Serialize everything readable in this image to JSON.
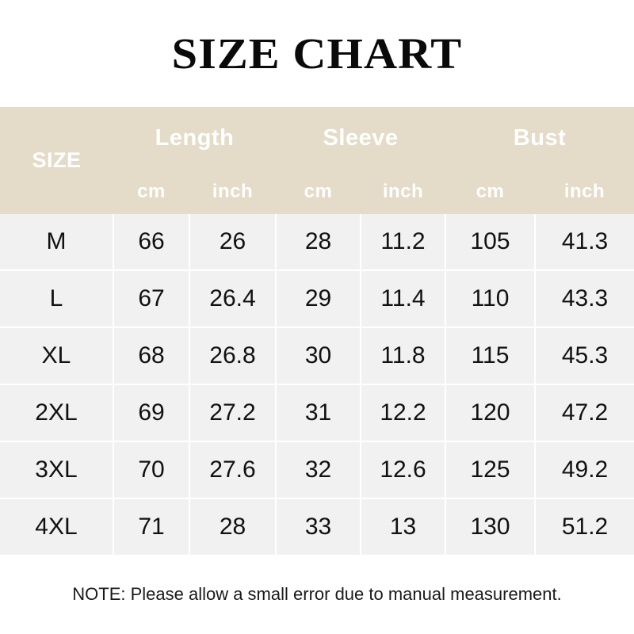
{
  "title": "SIZE CHART",
  "colors": {
    "header_band": "#e4dbc8",
    "cell_background": "#f1f1f1",
    "gridline": "#ffffff",
    "header_text": "#ffffff",
    "body_text": "#111111",
    "page_background": "#ffffff"
  },
  "table": {
    "size_column_header": "SIZE",
    "groups": [
      {
        "label": "Length",
        "units": [
          "cm",
          "inch"
        ]
      },
      {
        "label": "Sleeve",
        "units": [
          "cm",
          "inch"
        ]
      },
      {
        "label": "Bust",
        "units": [
          "cm",
          "inch"
        ]
      }
    ],
    "rows": [
      {
        "size": "M",
        "length_cm": "66",
        "length_inch": "26",
        "sleeve_cm": "28",
        "sleeve_inch": "11.2",
        "bust_cm": "105",
        "bust_inch": "41.3"
      },
      {
        "size": "L",
        "length_cm": "67",
        "length_inch": "26.4",
        "sleeve_cm": "29",
        "sleeve_inch": "11.4",
        "bust_cm": "110",
        "bust_inch": "43.3"
      },
      {
        "size": "XL",
        "length_cm": "68",
        "length_inch": "26.8",
        "sleeve_cm": "30",
        "sleeve_inch": "11.8",
        "bust_cm": "115",
        "bust_inch": "45.3"
      },
      {
        "size": "2XL",
        "length_cm": "69",
        "length_inch": "27.2",
        "sleeve_cm": "31",
        "sleeve_inch": "12.2",
        "bust_cm": "120",
        "bust_inch": "47.2"
      },
      {
        "size": "3XL",
        "length_cm": "70",
        "length_inch": "27.6",
        "sleeve_cm": "32",
        "sleeve_inch": "12.6",
        "bust_cm": "125",
        "bust_inch": "49.2"
      },
      {
        "size": "4XL",
        "length_cm": "71",
        "length_inch": "28",
        "sleeve_cm": "33",
        "sleeve_inch": "13",
        "bust_cm": "130",
        "bust_inch": "51.2"
      }
    ]
  },
  "note": "NOTE: Please allow a small error due to manual measurement.",
  "chart_data": {
    "type": "table",
    "title": "SIZE CHART",
    "columns": [
      "SIZE",
      "Length cm",
      "Length inch",
      "Sleeve cm",
      "Sleeve inch",
      "Bust cm",
      "Bust inch"
    ],
    "rows": [
      [
        "M",
        66,
        26,
        28,
        11.2,
        105,
        41.3
      ],
      [
        "L",
        67,
        26.4,
        29,
        11.4,
        110,
        43.3
      ],
      [
        "XL",
        68,
        26.8,
        30,
        11.8,
        115,
        45.3
      ],
      [
        "2XL",
        69,
        27.2,
        31,
        12.2,
        120,
        47.2
      ],
      [
        "3XL",
        70,
        27.6,
        32,
        12.6,
        125,
        49.2
      ],
      [
        "4XL",
        71,
        28,
        33,
        13,
        130,
        51.2
      ]
    ],
    "annotations": [
      "NOTE: Please allow a small error due to manual measurement."
    ]
  }
}
